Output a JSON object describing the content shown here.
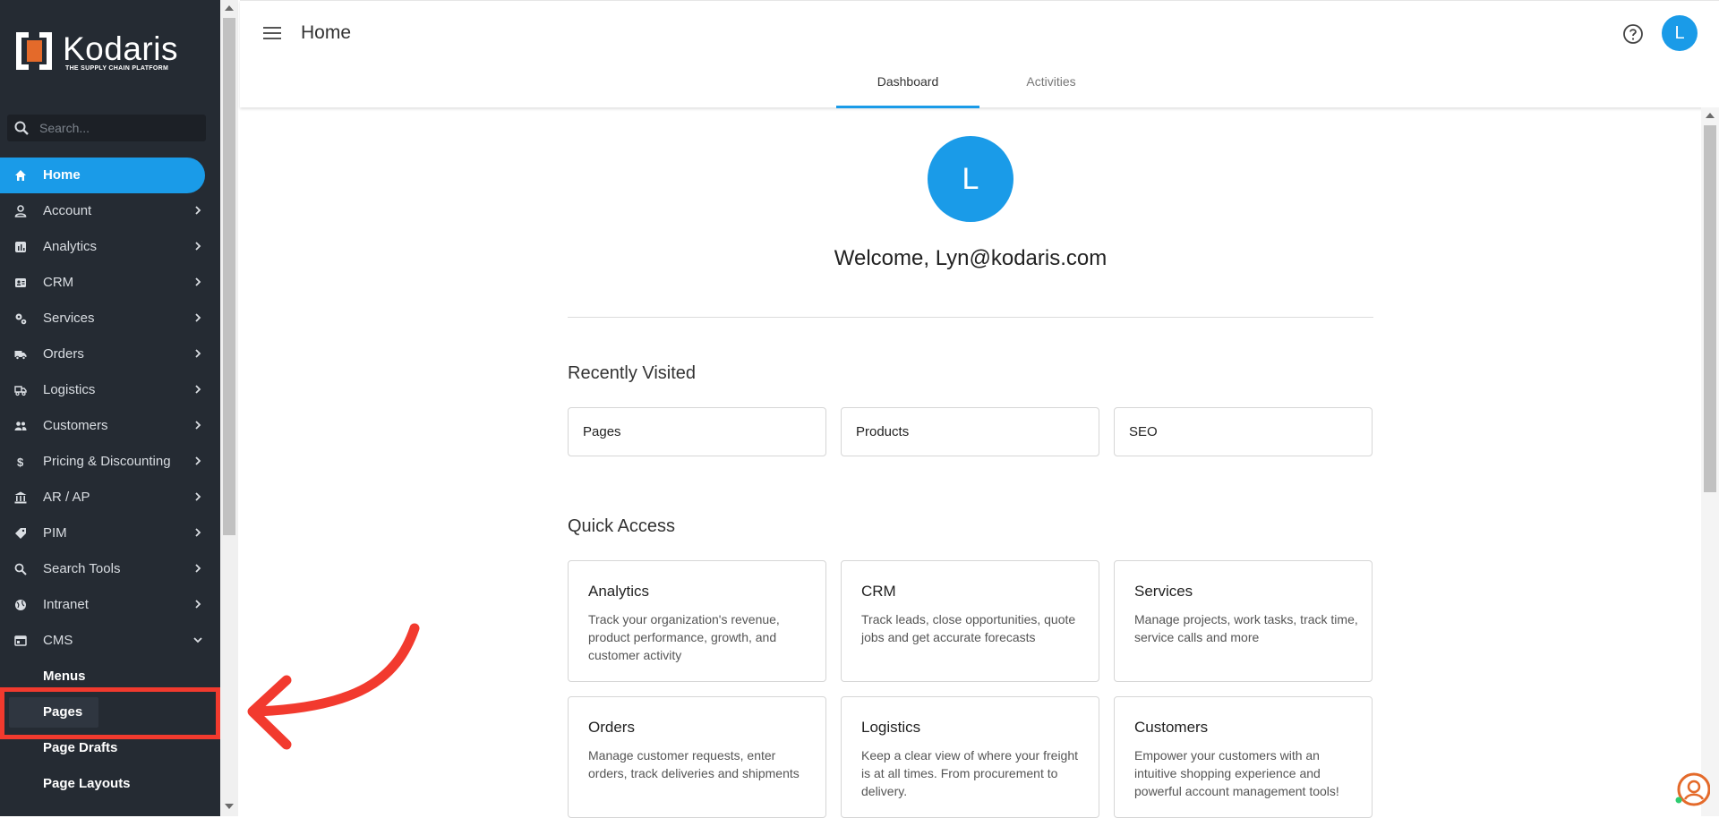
{
  "brand": {
    "name": "Kodaris",
    "tagline": "THE SUPPLY CHAIN PLATFORM",
    "accent": "#1a9be8",
    "logo_color": "#e46a2a"
  },
  "sidebar": {
    "search_placeholder": "Search...",
    "items": [
      {
        "label": "Home",
        "icon": "home-icon",
        "active": true
      },
      {
        "label": "Account",
        "icon": "person-icon"
      },
      {
        "label": "Analytics",
        "icon": "analytics-icon"
      },
      {
        "label": "CRM",
        "icon": "contact-card-icon"
      },
      {
        "label": "Services",
        "icon": "gears-icon"
      },
      {
        "label": "Orders",
        "icon": "truck-icon"
      },
      {
        "label": "Logistics",
        "icon": "shipping-icon"
      },
      {
        "label": "Customers",
        "icon": "people-icon"
      },
      {
        "label": "Pricing & Discounting",
        "icon": "dollar-icon"
      },
      {
        "label": "AR / AP",
        "icon": "bank-icon"
      },
      {
        "label": "PIM",
        "icon": "tag-icon"
      },
      {
        "label": "Search Tools",
        "icon": "search-icon"
      },
      {
        "label": "Intranet",
        "icon": "globe-icon"
      },
      {
        "label": "CMS",
        "icon": "web-icon",
        "expanded": true
      }
    ],
    "cms_sub": [
      "Menus",
      "Pages",
      "Page Drafts",
      "Page Layouts"
    ]
  },
  "header": {
    "title": "Home",
    "avatar_initial": "L"
  },
  "tabs": [
    {
      "label": "Dashboard",
      "active": true
    },
    {
      "label": "Activities"
    }
  ],
  "main": {
    "avatar_initial": "L",
    "welcome": "Welcome, Lyn@kodaris.com",
    "recent_title": "Recently Visited",
    "recent": [
      "Pages",
      "Products",
      "SEO"
    ],
    "quick_title": "Quick Access",
    "quick": [
      {
        "title": "Analytics",
        "desc": "Track your organization's revenue, product performance, growth, and customer activity"
      },
      {
        "title": "CRM",
        "desc": "Track leads, close opportunities, quote jobs and get accurate forecasts"
      },
      {
        "title": "Services",
        "desc": "Manage projects, work tasks, track time, service calls and more"
      },
      {
        "title": "Orders",
        "desc": "Manage customer requests, enter orders, track deliveries and shipments"
      },
      {
        "title": "Logistics",
        "desc": "Keep a clear view of where your freight is at all times. From procurement to delivery."
      },
      {
        "title": "Customers",
        "desc": "Empower your customers with an intuitive shopping experience and powerful account management tools!"
      }
    ]
  },
  "annotation": {
    "color": "#f23a2e"
  }
}
